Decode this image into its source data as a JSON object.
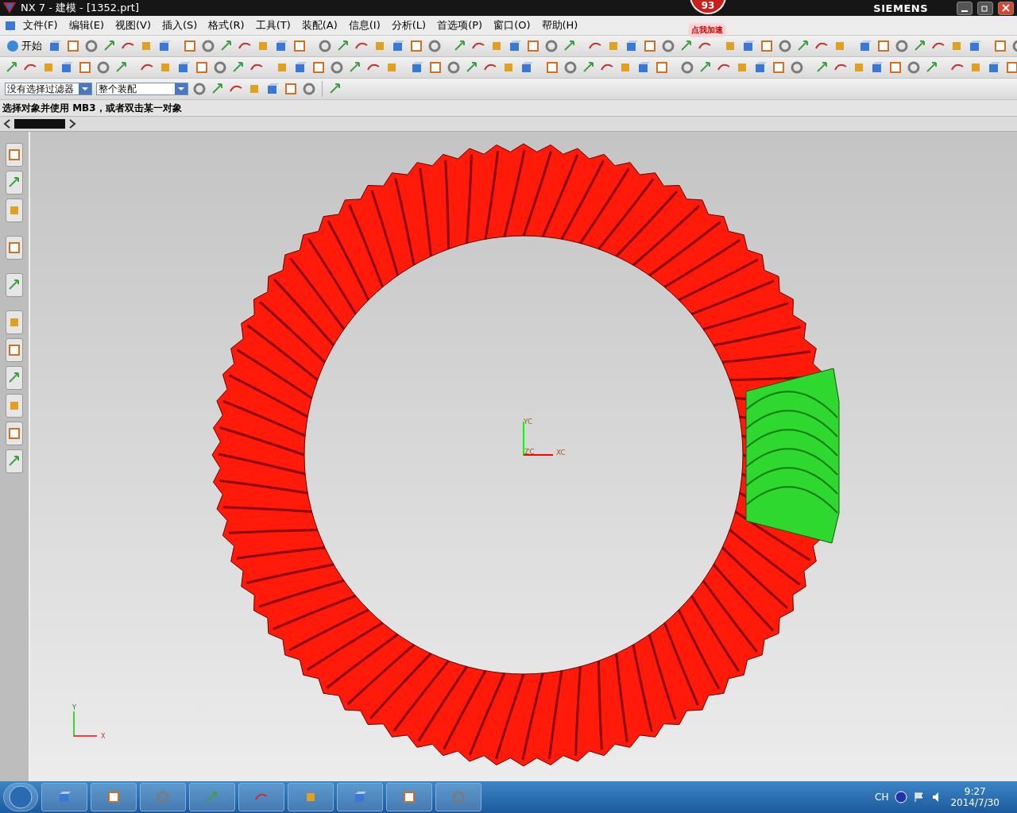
{
  "window": {
    "title": "NX 7 - 建模 - [1352.prt]",
    "brand": "SIEMENS"
  },
  "badge": {
    "count": "93",
    "label": "点我加速"
  },
  "menu": [
    "文件(F)",
    "编辑(E)",
    "视图(V)",
    "插入(S)",
    "格式(R)",
    "工具(T)",
    "装配(A)",
    "信息(I)",
    "分析(L)",
    "首选项(P)",
    "窗口(O)",
    "帮助(H)"
  ],
  "toolbar": {
    "start_label": "开始"
  },
  "selection_bar": {
    "filter": "没有选择过滤器",
    "scope": "整个装配"
  },
  "cue_line": "选择对象并使用 MB3，或者双击某一对象",
  "viewport": {
    "wcs_labels": [
      "YC",
      "ZC",
      "XC"
    ],
    "absolute_axes": [
      "Y",
      "X"
    ]
  },
  "taskbar": {
    "language": "CH",
    "time": "9:27",
    "date": "2014/7/30"
  }
}
